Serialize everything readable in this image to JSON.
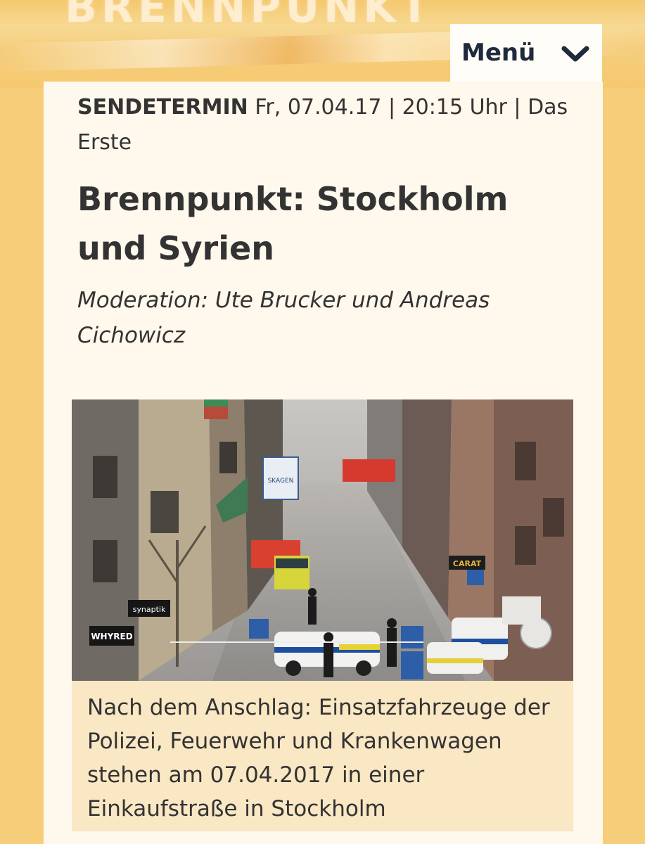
{
  "banner": {
    "logo_text": "BRENNPUNKT"
  },
  "menu": {
    "label": "Menü",
    "icon": "chevron-down-icon"
  },
  "article": {
    "sendetermin_label": "SENDETERMIN",
    "sendetermin_value": "Fr, 07.04.17 | 20:15 Uhr | Das Erste",
    "title": "Brennpunkt: Stockholm und Syrien",
    "moderation": "Moderation: Ute Brucker und Andreas Cichowicz"
  },
  "photo": {
    "caption": "Nach dem Anschlag: Einsatzfahrzeuge der Polizei, Feuerwehr und Krankenwagen stehen am 07.04.2017 in einer Einkaufstraße in Stockholm",
    "signs": {
      "skagen": "SKAGEN",
      "synaptik": "synaptik",
      "whyred": "WHYRED",
      "carat": "CARAT"
    }
  },
  "colors": {
    "background": "#f6ce7a",
    "card": "#fff8ec",
    "caption_bg": "#fae7c4",
    "menu_text": "#1f2a3c",
    "text": "#333333"
  }
}
